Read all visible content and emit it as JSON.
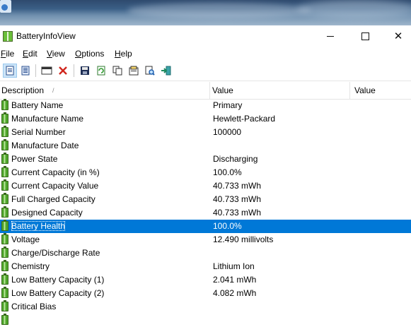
{
  "window": {
    "title": "BatteryInfoView"
  },
  "menu": [
    {
      "label": "File",
      "acc": "F",
      "rest": "ile"
    },
    {
      "label": "Edit",
      "acc": "E",
      "rest": "dit"
    },
    {
      "label": "View",
      "acc": "V",
      "rest": "iew"
    },
    {
      "label": "Options",
      "acc": "O",
      "rest": "ptions"
    },
    {
      "label": "Help",
      "acc": "H",
      "rest": "elp"
    }
  ],
  "toolbar": [
    {
      "name": "battery-info-mode-icon",
      "active": true
    },
    {
      "name": "battery-log-mode-icon",
      "active": false
    },
    {
      "name": "options-icon",
      "active": false
    },
    {
      "name": "delete-icon",
      "active": false
    },
    {
      "name": "save-icon",
      "active": false
    },
    {
      "name": "refresh-icon",
      "active": false
    },
    {
      "name": "copy-icon",
      "active": false
    },
    {
      "name": "properties-icon",
      "active": false
    },
    {
      "name": "find-icon",
      "active": false
    },
    {
      "name": "exit-icon",
      "active": false
    }
  ],
  "columns": [
    "Description",
    "Value",
    "Value"
  ],
  "selected_index": 9,
  "rows": [
    {
      "description": "Battery Name",
      "value": "Primary"
    },
    {
      "description": "Manufacture Name",
      "value": "Hewlett-Packard"
    },
    {
      "description": "Serial Number",
      "value": "100000"
    },
    {
      "description": "Manufacture Date",
      "value": ""
    },
    {
      "description": "Power State",
      "value": "Discharging"
    },
    {
      "description": "Current Capacity (in %)",
      "value": "100.0%"
    },
    {
      "description": "Current Capacity Value",
      "value": "40.733 mWh"
    },
    {
      "description": "Full Charged Capacity",
      "value": "40.733 mWh"
    },
    {
      "description": "Designed Capacity",
      "value": "40.733 mWh"
    },
    {
      "description": "Battery Health",
      "value": "100.0%"
    },
    {
      "description": "Voltage",
      "value": "12.490 millivolts"
    },
    {
      "description": "Charge/Discharge Rate",
      "value": ""
    },
    {
      "description": "Chemistry",
      "value": "Lithium Ion"
    },
    {
      "description": "Low Battery Capacity (1)",
      "value": "2.041 mWh"
    },
    {
      "description": "Low Battery Capacity (2)",
      "value": "4.082 mWh"
    },
    {
      "description": "Critical Bias",
      "value": ""
    },
    {
      "description": "",
      "value": ""
    }
  ],
  "colors": {
    "selection": "#0078d7",
    "battery_green": "#4ea52a"
  }
}
